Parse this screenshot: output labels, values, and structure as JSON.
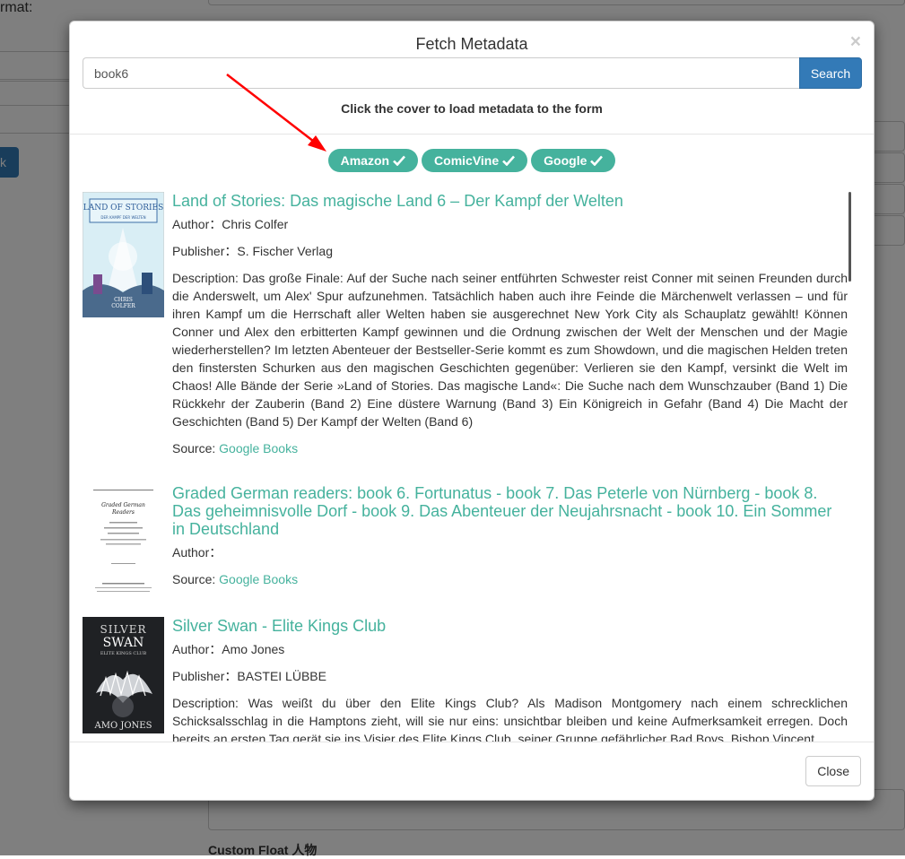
{
  "background": {
    "format_label": "rmat:",
    "button_label": "k",
    "custom_label": "Custom Float 人物"
  },
  "modal": {
    "title": "Fetch Metadata",
    "close_icon": "close-icon",
    "search": {
      "value": "book6",
      "button": "Search"
    },
    "hint": "Click the cover to load metadata to the form",
    "sources": [
      {
        "label": "Amazon",
        "icon": "check-icon"
      },
      {
        "label": "ComicVine",
        "icon": "check-icon"
      },
      {
        "label": "Google",
        "icon": "check-icon"
      }
    ],
    "results": [
      {
        "title": "Land of Stories: Das magische Land 6 – Der Kampf der Welten",
        "author_label": "Author：",
        "author": "Chris Colfer",
        "publisher_label": "Publisher：",
        "publisher": "S. Fischer Verlag",
        "description": "Description: Das große Finale: Auf der Suche nach seiner entführten Schwester reist Conner mit seinen Freunden durch die Anderswelt, um Alex' Spur aufzunehmen. Tatsächlich haben auch ihre Feinde die Märchenwelt verlassen – und für ihren Kampf um die Herrschaft aller Welten haben sie ausgerechnet New York City als Schauplatz gewählt! Können Conner und Alex den erbitterten Kampf gewinnen und die Ordnung zwischen der Welt der Menschen und der Magie wiederherstellen? Im letzten Abenteuer der Bestseller-Serie kommt es zum Showdown, und die magischen Helden treten den finstersten Schurken aus den magischen Geschichten gegenüber: Verlieren sie den Kampf, versinkt die Welt im Chaos! Alle Bände der Serie »Land of Stories. Das magische Land«: Die Suche nach dem Wunschzauber (Band 1) Die Rückkehr der Zauberin (Band 2) Eine düstere Warnung (Band 3) Ein Königreich in Gefahr (Band 4) Die Macht der Geschichten (Band 5) Der Kampf der Welten (Band 6)",
        "source_label": "Source:",
        "source": "Google Books",
        "cover_text": [
          "LAND OF STORIES",
          "DER KAMPF DER WELTEN",
          "CHRIS",
          "COLFER"
        ]
      },
      {
        "title": "Graded German readers: book 6. Fortunatus - book 7. Das Peterle von Nürnberg - book 8. Das geheimnisvolle Dorf - book 9. Das Abenteuer der Neujahrsnacht - book 10. Ein Sommer in Deutschland",
        "author_label": "Author：",
        "author": "",
        "source_label": "Source:",
        "source": "Google Books",
        "cover_text": [
          "Graded German",
          "Readers"
        ]
      },
      {
        "title": "Silver Swan - Elite Kings Club",
        "author_label": "Author：",
        "author": "Amo Jones",
        "publisher_label": "Publisher：",
        "publisher": "BASTEI LÜBBE",
        "description": "Description: Was weißt du über den Elite Kings Club? Als Madison Montgomery nach einem schrecklichen Schicksalsschlag in die Hamptons zieht, will sie nur eins: unsichtbar bleiben und keine Aufmerksamkeit erregen. Doch bereits an ersten Tag gerät sie ins Visier des Elite Kings Club, seiner Gruppe gefährlicher Bad Boys. Bishop Vincent",
        "cover_text": [
          "SILVER",
          "SWAN",
          "ELITE KINGS CLUB",
          "AMO JONES"
        ]
      }
    ],
    "footer": {
      "close": "Close"
    }
  },
  "colors": {
    "accent": "#45b29d",
    "primary": "#337ab7",
    "arrow": "#ff0000"
  }
}
